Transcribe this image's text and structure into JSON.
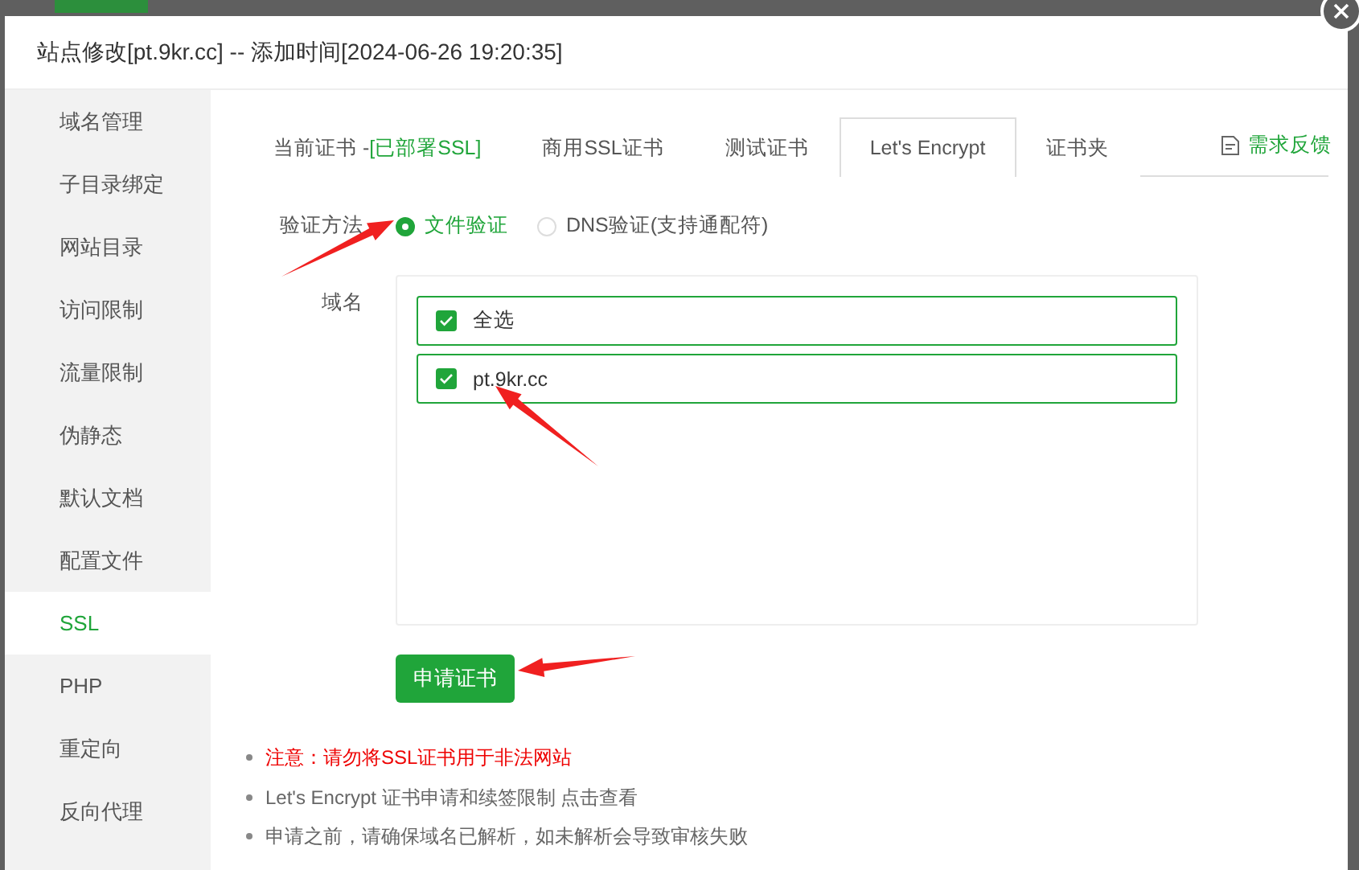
{
  "dialog": {
    "title": "站点修改[pt.9kr.cc] -- 添加时间[2024-06-26 19:20:35]"
  },
  "sidebar": {
    "items": [
      {
        "label": "域名管理",
        "selected": false
      },
      {
        "label": "子目录绑定",
        "selected": false
      },
      {
        "label": "网站目录",
        "selected": false
      },
      {
        "label": "访问限制",
        "selected": false
      },
      {
        "label": "流量限制",
        "selected": false
      },
      {
        "label": "伪静态",
        "selected": false
      },
      {
        "label": "默认文档",
        "selected": false
      },
      {
        "label": "配置文件",
        "selected": false
      },
      {
        "label": "SSL",
        "selected": true
      },
      {
        "label": "PHP",
        "selected": false
      },
      {
        "label": "重定向",
        "selected": false
      },
      {
        "label": "反向代理",
        "selected": false
      }
    ]
  },
  "tabs": [
    {
      "label": "当前证书 -",
      "status": "[已部署SSL]",
      "selected": false
    },
    {
      "label": "商用SSL证书",
      "selected": false
    },
    {
      "label": "测试证书",
      "selected": false
    },
    {
      "label": "Let's Encrypt",
      "selected": true
    },
    {
      "label": "证书夹",
      "selected": false
    }
  ],
  "feedback_link": "需求反馈",
  "verification": {
    "label": "验证方法",
    "options": [
      {
        "label": "文件验证",
        "selected": true
      },
      {
        "label": "DNS验证(支持通配符)",
        "selected": false
      }
    ]
  },
  "domains": {
    "label": "域名",
    "items": [
      {
        "label": "全选",
        "checked": true
      },
      {
        "label": "pt.9kr.cc",
        "checked": true
      }
    ]
  },
  "apply_button": "申请证书",
  "notes": [
    {
      "kind": "warning",
      "text": "注意：请勿将SSL证书用于非法网站"
    },
    {
      "kind": "info",
      "text": "Let's Encrypt 证书申请和续签限制 点击查看"
    },
    {
      "kind": "info",
      "text": "申请之前，请确保域名已解析，如未解析会导致审核失败"
    }
  ]
}
